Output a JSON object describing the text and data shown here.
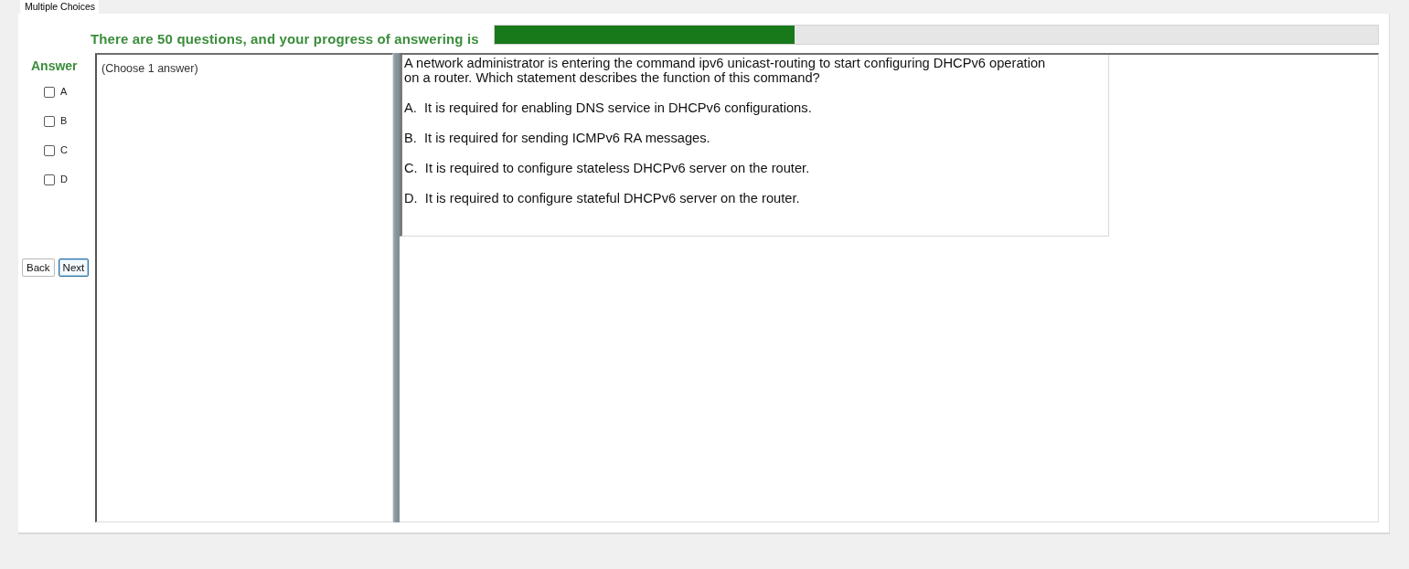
{
  "tab": {
    "label": "Multiple Choices",
    "selected": true
  },
  "progress": {
    "label": "There are 50 questions, and your progress of answering is",
    "level": 0.34
  },
  "answer": {
    "title": "Answer",
    "options": [
      {
        "label": "A",
        "checked": false
      },
      {
        "label": "B",
        "checked": false
      },
      {
        "label": "C",
        "checked": false
      },
      {
        "label": "D",
        "checked": false
      }
    ]
  },
  "buttons": [
    {
      "label": "Back",
      "focused": false
    },
    {
      "label": "Next",
      "focused": true
    }
  ],
  "instruction": "(Choose 1 answer)",
  "question": {
    "text": "A network administrator is entering the command ipv6 unicast-routing to start configuring DHCPv6 operation on a router. Which statement describes the function of this command?",
    "choices": [
      "A.  It is required for enabling DNS service in DHCPv6 configurations.",
      "B.  It is required for sending ICMPv6 RA messages.",
      "C.  It is required to configure stateless DHCPv6 server on the router.",
      "D.  It is required to configure stateful DHCPv6 server on the router."
    ]
  }
}
